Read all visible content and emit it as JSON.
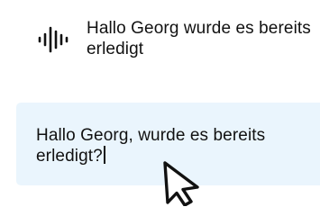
{
  "transcript": {
    "icon": "voice-waveform-icon",
    "text": "Hallo Georg wurde es bereits erledigt"
  },
  "input": {
    "value": "Hallo Georg, wurde es bereits erledigt?",
    "background": "#eaf5fd"
  },
  "cursor": {
    "icon": "mouse-pointer-icon"
  }
}
